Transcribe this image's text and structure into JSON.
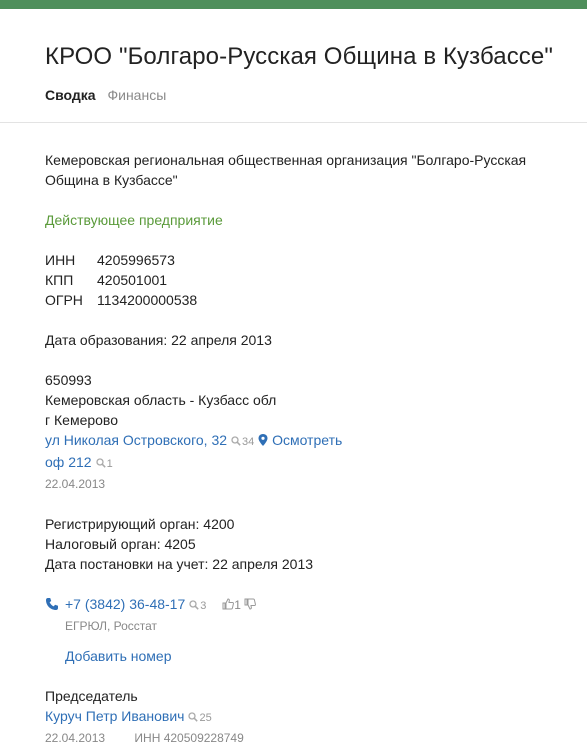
{
  "header": {
    "title": "КРОО \"Болгаро-Русская Община в Кузбассе\"",
    "tabs": [
      {
        "label": "Сводка",
        "active": true
      },
      {
        "label": "Финансы",
        "active": false
      }
    ]
  },
  "org": {
    "full_name": "Кемеровская региональная общественная организация \"Болгаро-Русская Община в Кузбассе\"",
    "status": "Действующее предприятие",
    "ids": [
      {
        "key": "ИНН",
        "value": "4205996573"
      },
      {
        "key": "КПП",
        "value": "420501001"
      },
      {
        "key": "ОГРН",
        "value": "1134200000538"
      }
    ],
    "founded": "Дата образования: 22 апреля 2013"
  },
  "address": {
    "postal_code": "650993",
    "region": "Кемеровская область - Кузбасс обл",
    "city": "г Кемерово",
    "street": "ул Николая Островского, 32",
    "street_count": "34",
    "map_link": "Осмотреть",
    "office": "оф 212",
    "office_count": "1",
    "date": "22.04.2013"
  },
  "registration": {
    "registrar": "Регистрирующий орган: 4200",
    "tax": "Налоговый орган: 4205",
    "date": "Дата постановки на учет: 22 апреля 2013"
  },
  "contacts": {
    "phone": "+7 (3842) 36-48-17",
    "phone_count": "3",
    "likes": "1",
    "source": "ЕГРЮЛ, Росстат",
    "add_phone": "Добавить номер"
  },
  "head": {
    "role": "Председатель",
    "name": "Куруч Петр Иванович",
    "name_count": "25",
    "date": "22.04.2013",
    "inn": "ИНН 420509228749"
  },
  "colors": {
    "topbar": "#4e8f5b",
    "link": "#2f6fb6",
    "status_green": "#5a9a3a"
  }
}
